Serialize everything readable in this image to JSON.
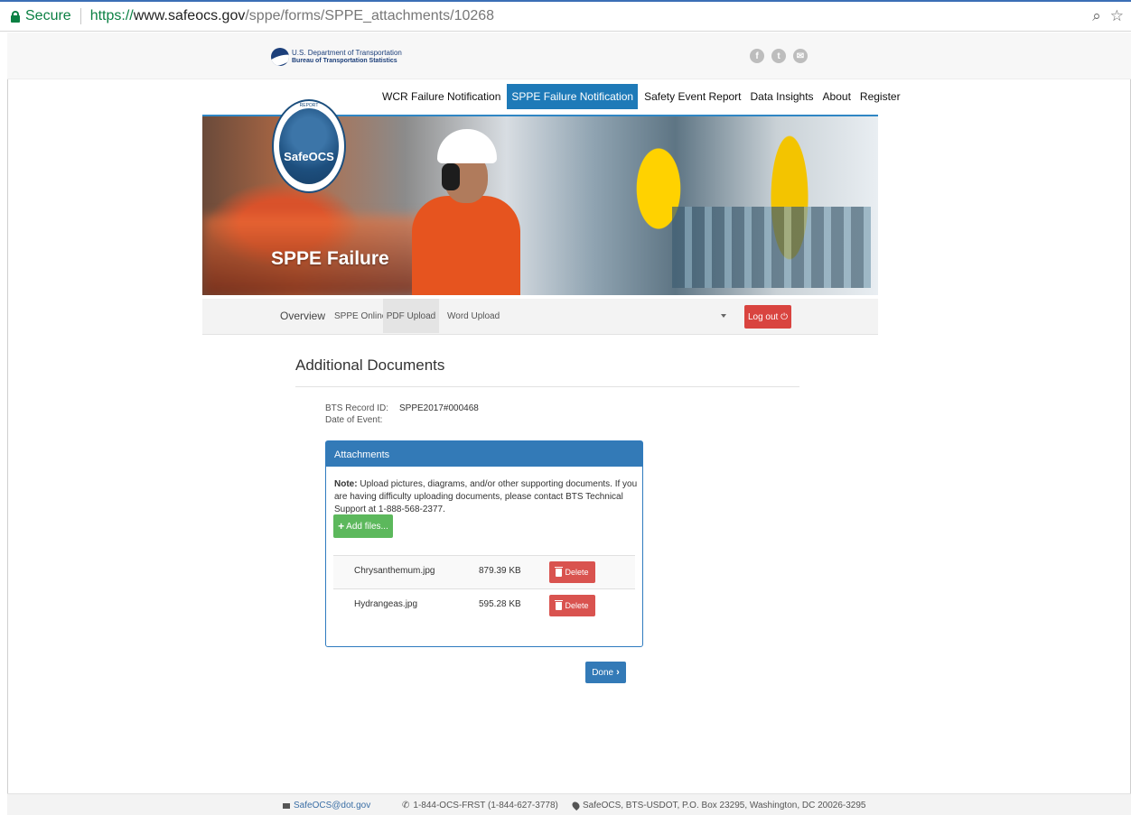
{
  "browser": {
    "secure_label": "Secure",
    "url_scheme": "https://",
    "url_host": "www.safeocs.gov",
    "url_path": "/sppe/forms/SPPE_attachments/10268"
  },
  "header": {
    "dot_line1": "U.S. Department of Transportation",
    "dot_line2": "Bureau of Transportation Statistics",
    "social": [
      "f",
      "t",
      "✉"
    ]
  },
  "nav": {
    "items": [
      "WCR Failure Notification",
      "SPPE Failure Notification",
      "Safety Event Report",
      "Data Insights",
      "About",
      "Register"
    ]
  },
  "hero": {
    "title": "SPPE Failure",
    "badge_label": "SafeOCS",
    "badge_ring": "REPORT"
  },
  "subnav": {
    "overview": "Overview",
    "sppe_online": "SPPE Online",
    "pdf_upload": "PDF Upload",
    "word_upload": "Word Upload",
    "logout": "Log out ⏻"
  },
  "content": {
    "heading": "Additional Documents",
    "record_label": "BTS Record ID:",
    "record_value": "SPPE2017#000468",
    "date_label": "Date of Event:"
  },
  "attachments": {
    "title": "Attachments",
    "note_bold": "Note:",
    "note_text": " Upload pictures, diagrams, and/or other supporting documents. If you are having difficulty uploading documents, please contact BTS Technical Support at 1-888-568-2377.",
    "add_files": "Add files...",
    "delete_label": "Delete",
    "files": [
      {
        "name": "Chrysanthemum.jpg",
        "size": "879.39 KB"
      },
      {
        "name": "Hydrangeas.jpg",
        "size": "595.28 KB"
      }
    ]
  },
  "done_label": "Done",
  "footer": {
    "email": "SafeOCS@dot.gov",
    "phone": "1-844-OCS-FRST (1-844-627-3778)",
    "address": "SafeOCS, BTS-USDOT, P.O. Box 23295, Washington, DC 20026-3295"
  },
  "colors": {
    "primary": "#337ab7",
    "nav_active": "#1e7ab8",
    "danger": "#d9534f",
    "success": "#5cb85c",
    "secure_green": "#0b8043"
  }
}
